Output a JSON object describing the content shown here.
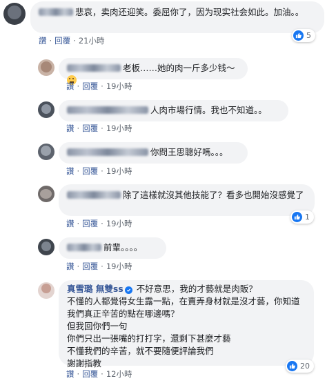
{
  "colors": {
    "link": "#385898",
    "bubble": "#f2f3f5",
    "meta": "#606770",
    "like": "#1877f2"
  },
  "comments": [
    {
      "name": "",
      "text": "悲哀，卖肉还迎笑。委屈你了，因为现实社会如此。加油。。",
      "like": "讚",
      "reply": "回覆",
      "time": "21小時",
      "reactions": "5"
    },
    {
      "name": "",
      "name_tail": "老板",
      "text": "……她的肉一斤多少钱～",
      "like": "讚",
      "reply": "回覆",
      "time": "19小時",
      "emoji": "thinking-face"
    },
    {
      "name": "",
      "text": "人肉市場行情。我也不知道。。",
      "like": "讚",
      "reply": "回覆",
      "time": "19小時"
    },
    {
      "name": "",
      "text": "你問王思聰好嗎。。。",
      "like": "讚",
      "reply": "回覆",
      "time": "19小時"
    },
    {
      "name": "",
      "text": "除了這樣就沒其他技能了？看多也開始沒感覺了",
      "like": "讚",
      "reply": "回覆",
      "time": "19小時",
      "reactions": "1"
    },
    {
      "name": "",
      "text": "前輩。。。。",
      "like": "讚",
      "reply": "回覆",
      "time": "19小時"
    },
    {
      "name": "真雪璐 無雙ss",
      "lines": [
        "不好意思，我的才藝就是肉販？",
        "不懂的人都覺得女生露一點，在賣弄身材就是沒才藝，你知道我們真正辛苦的點在哪邊嗎？",
        "但我回你們一句",
        "你們只出一張嘴的打打字，還剩下甚麼才藝",
        "不懂我們的辛苦，就不要隨便評論我們",
        "謝謝指教"
      ],
      "like": "讚",
      "reply": "回覆",
      "time": "12小時",
      "reactions": "20"
    }
  ]
}
